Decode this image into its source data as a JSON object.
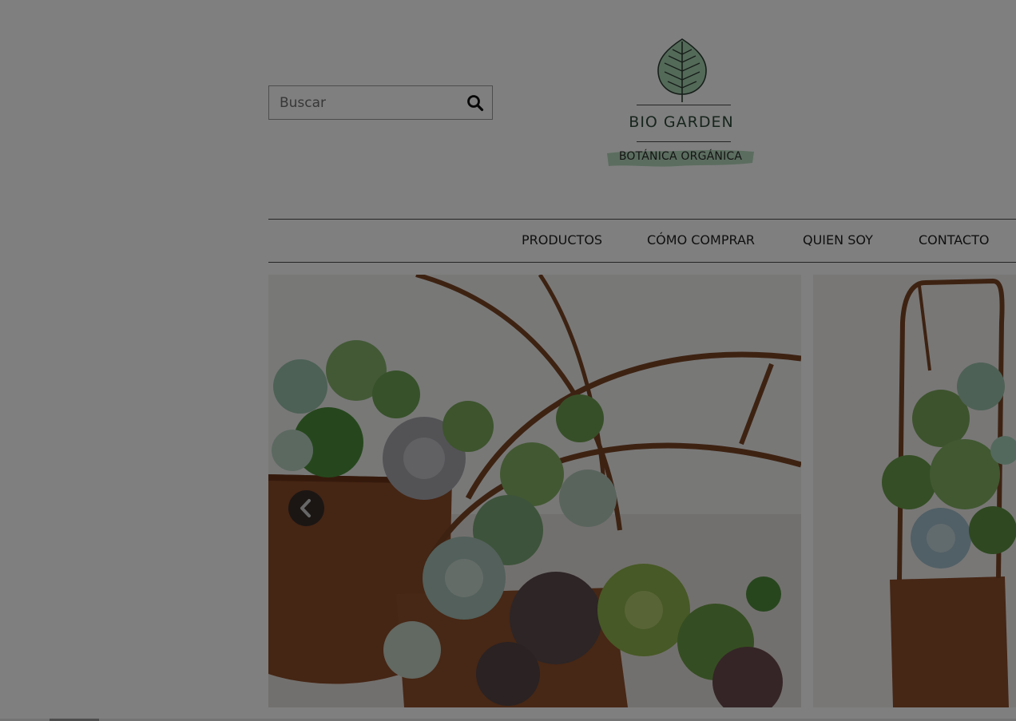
{
  "search": {
    "placeholder": "Buscar",
    "value": "",
    "icon": "search-icon"
  },
  "logo": {
    "name": "BIO GARDEN",
    "tagline": "BOTÁNICA ORGÁNICA",
    "icon": "leaf-icon",
    "colors": {
      "leaf": "#a9d4b3",
      "text": "#2f4a3b"
    }
  },
  "nav": {
    "items": [
      {
        "label": "PRODUCTOS"
      },
      {
        "label": "CÓMO COMPRAR"
      },
      {
        "label": "QUIEN SOY"
      },
      {
        "label": "CONTACTO"
      }
    ]
  },
  "carousel": {
    "prev_icon": "chevron-left-icon",
    "slides": [
      {
        "alt": "",
        "kind": "succulents-in-rusty-metal-planter"
      },
      {
        "alt": "",
        "kind": "succulents-in-tall-rusty-planter"
      }
    ]
  },
  "overlay": {
    "color": "#000000",
    "opacity": 0.5
  }
}
